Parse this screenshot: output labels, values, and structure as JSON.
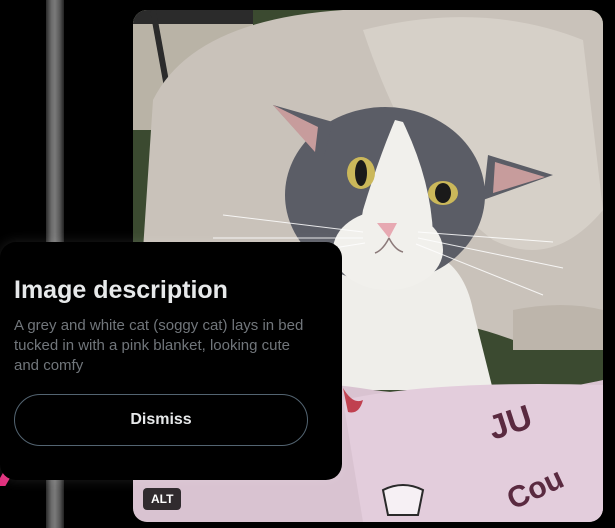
{
  "popover": {
    "title": "Image description",
    "description": "A grey and white cat (soggy cat) lays in bed tucked in with a pink blanket, looking cute and comfy",
    "dismiss_label": "Dismiss"
  },
  "media": {
    "alt_badge": "ALT"
  },
  "colors": {
    "background": "#000000",
    "title_text": "#e7e9ea",
    "body_text": "#71767b",
    "button_border": "#536471",
    "accent_pink": "#e0307d"
  }
}
